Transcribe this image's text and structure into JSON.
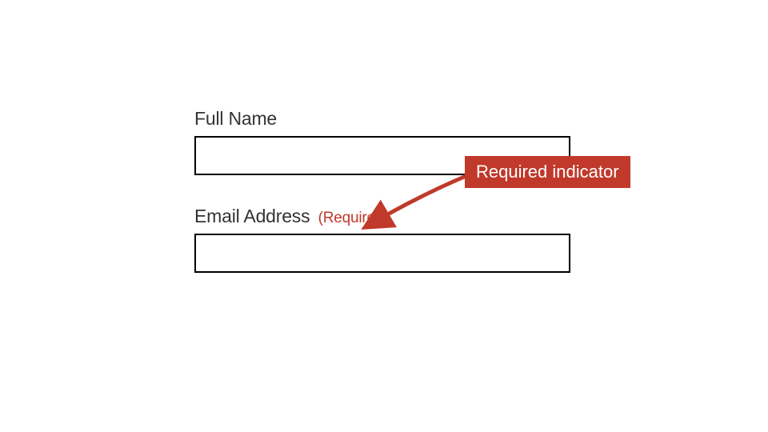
{
  "form": {
    "fields": [
      {
        "label": "Full Name",
        "required_text": "",
        "value": ""
      },
      {
        "label": "Email Address",
        "required_text": "(Required)",
        "value": ""
      }
    ]
  },
  "callout": {
    "text": "Required indicator"
  },
  "colors": {
    "required": "#c0392b",
    "text": "#333333",
    "border": "#000000"
  }
}
